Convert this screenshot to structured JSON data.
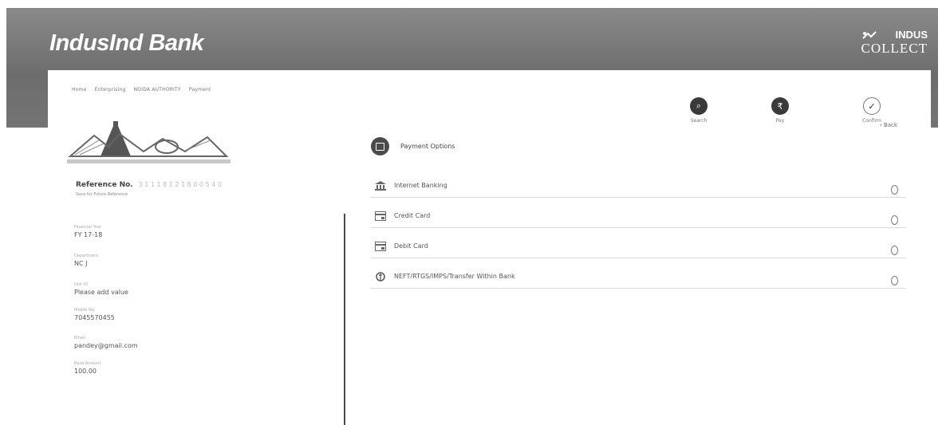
{
  "header": {
    "bank_name": "IndusInd Bank",
    "product_top": "INDUS",
    "product_bottom": "COLLECT"
  },
  "breadcrumb": [
    "Home",
    "Enterprising",
    "NOIDA AUTHORITY",
    "Payment"
  ],
  "steps": [
    {
      "label": "Search",
      "glyph": "⌕",
      "state": "active"
    },
    {
      "label": "Pay",
      "glyph": "₹",
      "state": "active"
    },
    {
      "label": "Confirm",
      "glyph": "✓",
      "state": "done"
    }
  ],
  "back_label": "‹ Back",
  "reference": {
    "label": "Reference No.",
    "value": "3 1 1 1 8 1 2 1 8 0 0 5 4 0",
    "note": "Save for Future Reference"
  },
  "details": [
    {
      "label": "Financial Year",
      "value": "FY 17-18"
    },
    {
      "label": "Department",
      "value": "NC J"
    },
    {
      "label": "Unit ID",
      "value": "Please add value"
    },
    {
      "label": "Mobile No.",
      "value": "7045570455"
    },
    {
      "label": "Email",
      "value": "pandey@gmail.com"
    },
    {
      "label": "Base Amount",
      "value": "100.00"
    }
  ],
  "payment_options": {
    "title": "Payment Options",
    "items": [
      {
        "label": "Internet Banking",
        "icon": "bank-icon"
      },
      {
        "label": "Credit Card",
        "icon": "card-icon"
      },
      {
        "label": "Debit Card",
        "icon": "card-icon"
      },
      {
        "label": "NEFT/RTGS/IMPS/Transfer Within Bank",
        "icon": "transfer-icon"
      }
    ]
  },
  "colors": {
    "header_bg": "#747474",
    "step_active": "#3a3a3a",
    "divider": "#4a4a4a"
  }
}
